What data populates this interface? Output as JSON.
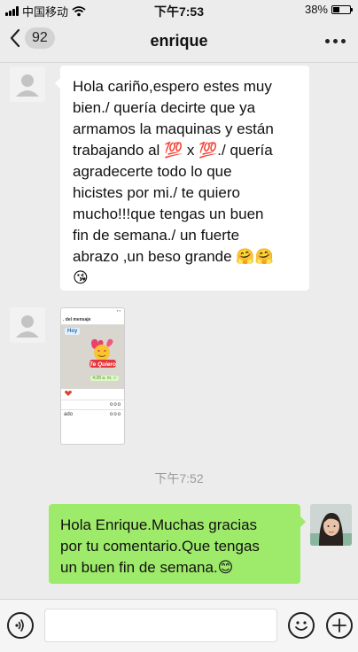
{
  "status_bar": {
    "carrier": "中国移动",
    "time": "下午7:53",
    "battery": "38%",
    "battery_level": 0.38
  },
  "nav": {
    "back_count": "92",
    "title": "enrique"
  },
  "messages": {
    "incoming_text": {
      "lines": [
        "Hola cariño,espero estes muy",
        "bien./ quería decirte que ya",
        "armamos la maquinas y están",
        "trabajando al 💯 x 💯./ quería",
        "agradecerte todo lo que",
        "hicistes por mi./ te quiero",
        "mucho!!!que tengas un buen",
        "fin de semana./ un fuerte",
        "abrazo ,un beso grande 🤗🤗",
        "😘"
      ]
    },
    "incoming_image": {
      "header": ". del mensaje",
      "tag": "Hoy",
      "sticker_text": "Te Quiero",
      "time": "4:28 a. m. ✓",
      "row_text": "ado",
      "row_dots": "ooo"
    },
    "timestamp": "下午7:52",
    "outgoing_text": {
      "lines": [
        "Hola Enrique.Muchas gracias",
        "por tu comentario.Que tengas",
        "un buen fin de semana.😊"
      ]
    }
  }
}
